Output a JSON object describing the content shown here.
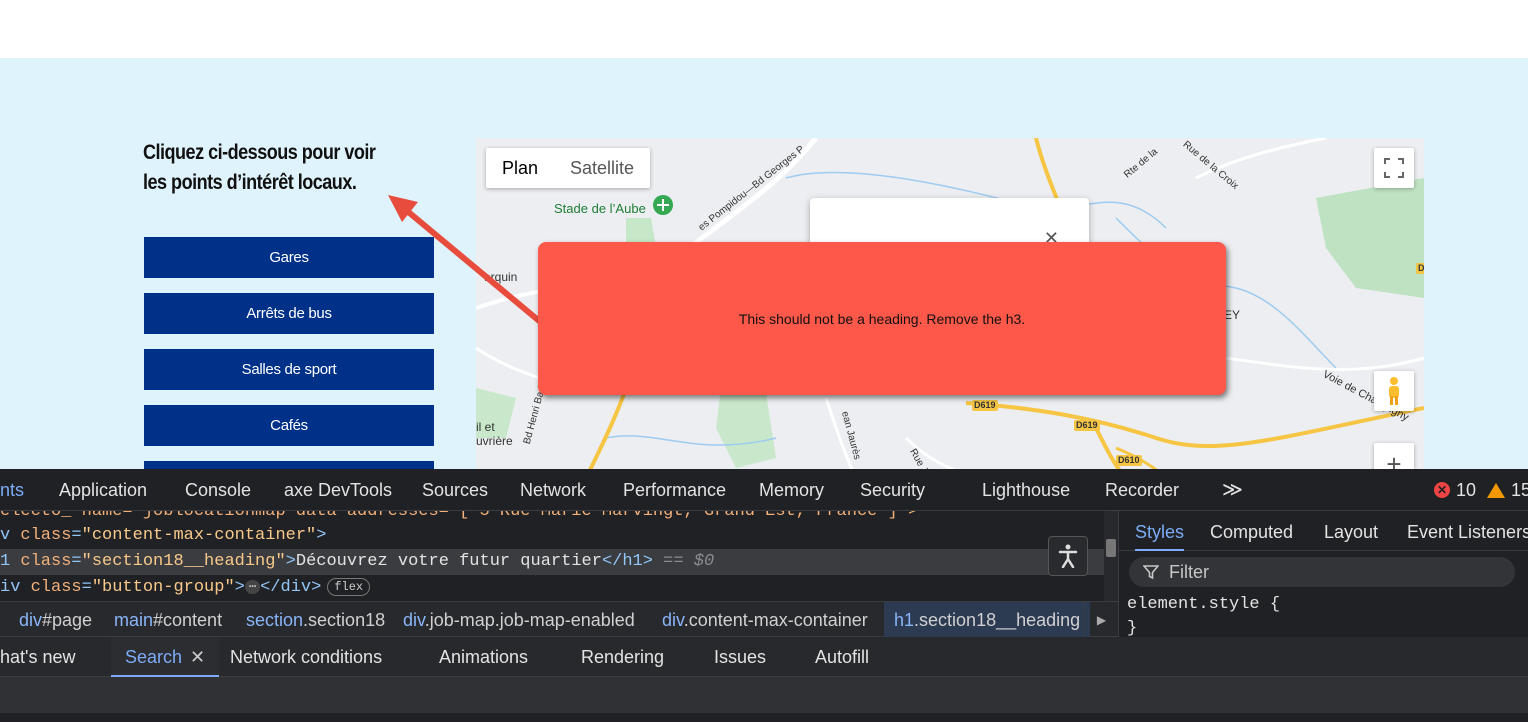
{
  "page": {
    "heading": "Cliquez ci-dessous pour voir les points d’intérêt locaux.",
    "buttons": [
      "Gares",
      "Arrêts de bus",
      "Salles de sport",
      "Cafés"
    ]
  },
  "map": {
    "type_plan": "Plan",
    "type_satellite": "Satellite",
    "labels": {
      "stade": "Stade de l’Aube",
      "bd_georges": "Bd Georges Po",
      "pompidou": "es Pompidou—Bd Georges P",
      "rte": "Rte de la",
      "rue_croix": "Rue de la Croix",
      "marquin": "arquin",
      "bd_henri": "Bd Henri Barbusse",
      "riviere": "il et\nuvrière",
      "jean_jaures": "ean Jaurès",
      "rue_je": "Rue Je",
      "voie_champigny": "Voie de Champigny",
      "ey": "EY"
    },
    "road_shields": [
      "D619",
      "D619",
      "D610",
      "D"
    ]
  },
  "annotation": {
    "text": "This should not be a heading. Remove the h3.",
    "color": "#fd5849"
  },
  "devtools": {
    "tabs": [
      "nts",
      "Application",
      "Console",
      "axe DevTools",
      "Sources",
      "Network",
      "Performance",
      "Memory",
      "Security",
      "Lighthouse",
      "Recorder"
    ],
    "more": "≫",
    "errors": "10",
    "warnings": "15",
    "code": {
      "line0": "electo_-name= joblocationmap data-addresses= [ 5 Rue Marie Marvingt, Grand Est, France ] >",
      "line1_pre": "v ",
      "line1_attr": "class",
      "line1_val": "\"content-max-container\"",
      "line2_tag_open": "1 ",
      "line2_attr": "class",
      "line2_val": "\"section18__heading\"",
      "line2_text": "Découvrez votre futur quartier",
      "line2_tag_close": "</h1>",
      "line2_eq": "== $0",
      "line3_pre": "iv ",
      "line3_attr": "class",
      "line3_val": "\"button-group\"",
      "line3_close": "</div>",
      "ellipsis": "⋯",
      "flex_pill": "flex"
    },
    "breadcrumb": [
      {
        "tag": "div",
        "rest": "#page"
      },
      {
        "tag": "main",
        "rest": "#content"
      },
      {
        "tag": "section",
        "rest": ".section18"
      },
      {
        "tag": "div",
        "rest": ".job-map.job-map-enabled"
      },
      {
        "tag": "div",
        "rest": ".content-max-container"
      },
      {
        "tag": "h1",
        "rest": ".section18__heading"
      }
    ],
    "styles_tabs": [
      "Styles",
      "Computed",
      "Layout",
      "Event Listeners"
    ],
    "filter_placeholder": "Filter",
    "style_rule": "element.style {\n}",
    "drawer_tabs": [
      "hat's new",
      "Search",
      "Network conditions",
      "Animations",
      "Rendering",
      "Issues",
      "Autofill"
    ]
  }
}
